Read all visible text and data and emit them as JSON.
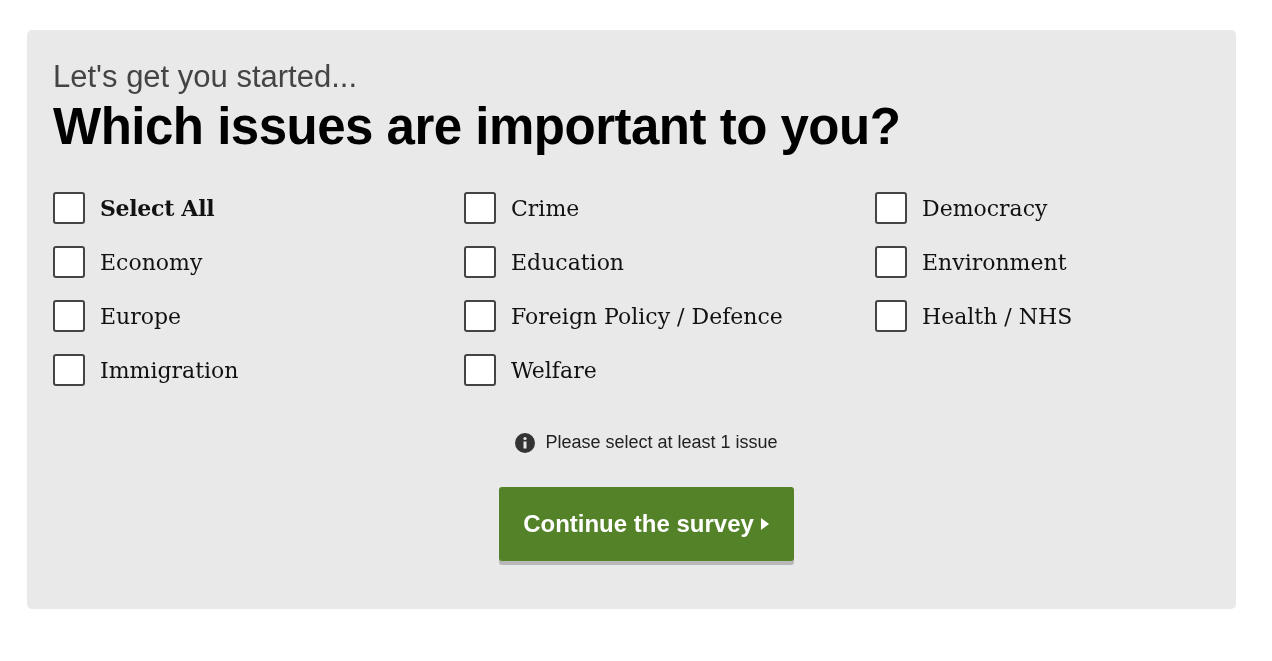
{
  "intro": "Let's get you started...",
  "heading": "Which issues are important to you?",
  "issues": [
    {
      "label": "Select All",
      "kind": "select_all",
      "checked": false
    },
    {
      "label": "Crime",
      "kind": "issue",
      "checked": false
    },
    {
      "label": "Democracy",
      "kind": "issue",
      "checked": false
    },
    {
      "label": "Economy",
      "kind": "issue",
      "checked": false
    },
    {
      "label": "Education",
      "kind": "issue",
      "checked": false
    },
    {
      "label": "Environment",
      "kind": "issue",
      "checked": false
    },
    {
      "label": "Europe",
      "kind": "issue",
      "checked": false
    },
    {
      "label": "Foreign Policy / Defence",
      "kind": "issue",
      "checked": false
    },
    {
      "label": "Health / NHS",
      "kind": "issue",
      "checked": false
    },
    {
      "label": "Immigration",
      "kind": "issue",
      "checked": false
    },
    {
      "label": "Welfare",
      "kind": "issue",
      "checked": false
    }
  ],
  "hint": "Please select at least 1 issue",
  "continue_button": "Continue the survey"
}
